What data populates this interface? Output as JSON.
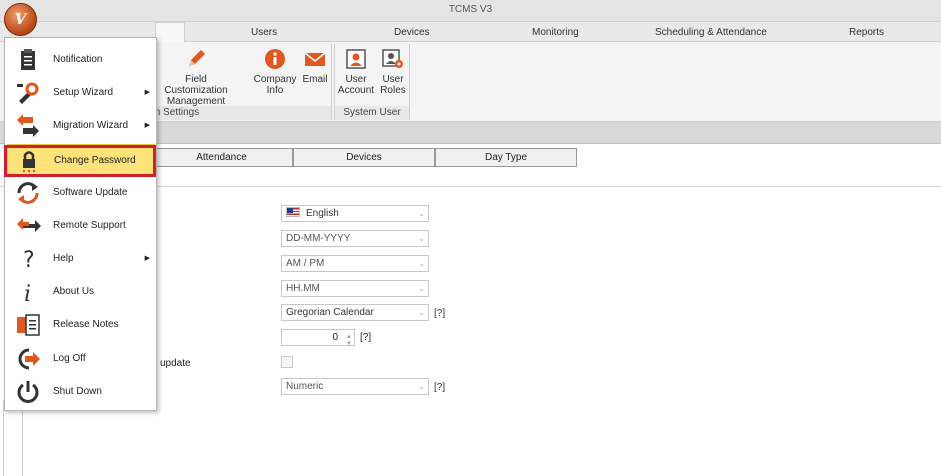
{
  "window": {
    "title": "TCMS V3"
  },
  "tabs": [
    {
      "label": "Users"
    },
    {
      "label": "Devices"
    },
    {
      "label": "Monitoring"
    },
    {
      "label": "Scheduling & Attendance"
    },
    {
      "label": "Reports"
    }
  ],
  "ribbon": {
    "group_system_settings": {
      "label": "m Settings",
      "field_customization": "Field Customization Management",
      "company_info": "Company Info",
      "email": "Email"
    },
    "group_system_user": {
      "label": "System User",
      "user_account": "User Account",
      "user_roles": "User Roles"
    }
  },
  "subtabs": [
    {
      "label": "Attendance"
    },
    {
      "label": "Devices"
    },
    {
      "label": "Day Type"
    }
  ],
  "settings": {
    "language": "English",
    "date_format": "DD-MM-YYYY",
    "time_format": "AM / PM",
    "duration_format": "HH.MM",
    "calendar": "Gregorian Calendar",
    "number_value": "0",
    "update_label": "update",
    "number_type": "Numeric",
    "help_marker": "[?]"
  },
  "app_menu": {
    "items": [
      {
        "label": "Notification",
        "icon": "clipboard-icon",
        "submenu": false
      },
      {
        "label": "Setup Wizard",
        "icon": "wrench-icon",
        "submenu": true
      },
      {
        "label": "Migration Wizard",
        "icon": "migration-arrows-icon",
        "submenu": true
      },
      {
        "label": "Change Password",
        "icon": "lock-icon",
        "submenu": false,
        "selected": true
      },
      {
        "label": "Software Update",
        "icon": "refresh-icon",
        "submenu": false
      },
      {
        "label": "Remote Support",
        "icon": "remote-arrows-icon",
        "submenu": false
      },
      {
        "label": "Help",
        "icon": "question-icon",
        "submenu": true
      },
      {
        "label": "About Us",
        "icon": "info-icon",
        "submenu": false
      },
      {
        "label": "Release Notes",
        "icon": "notes-icon",
        "submenu": false
      },
      {
        "label": "Log Off",
        "icon": "logoff-icon",
        "submenu": false
      },
      {
        "label": "Shut Down",
        "icon": "power-icon",
        "submenu": false
      }
    ],
    "arrow_glyph": "▶"
  },
  "colors": {
    "accent_orange": "#e0581f",
    "highlight_red": "#d21f2e",
    "selected_yellow": "#fde27a"
  }
}
